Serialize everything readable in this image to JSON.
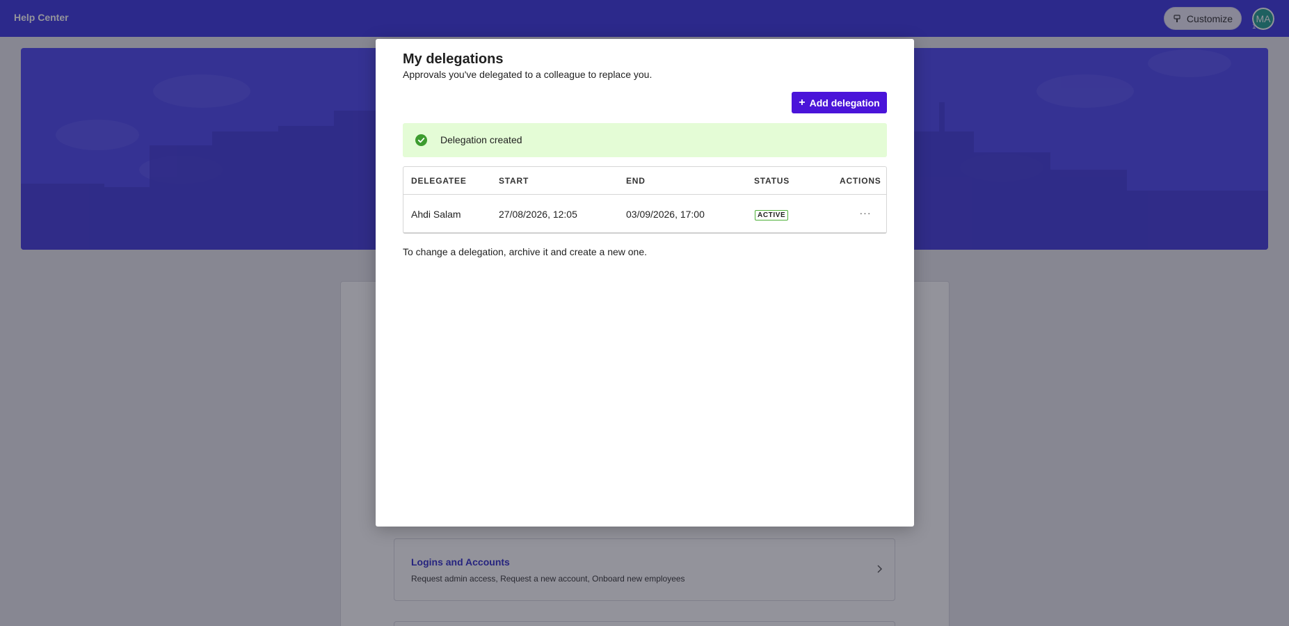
{
  "header": {
    "brand": "Help Center",
    "customize_label": "Customize",
    "avatar_initials": "MA",
    "avatar_badge": "1"
  },
  "page": {
    "category": {
      "title": "Logins and Accounts",
      "description": "Request admin access, Request a new account, Onboard new employees"
    }
  },
  "modal": {
    "title": "My delegations",
    "subtitle": "Approvals you've delegated to a colleague to replace you.",
    "add_button_label": "Add delegation",
    "alert_message": "Delegation created",
    "table": {
      "columns": [
        "DELEGATEE",
        "START",
        "END",
        "STATUS",
        "ACTIONS"
      ],
      "rows": [
        {
          "delegatee": "Ahdi Salam",
          "start": "27/08/2026, 12:05",
          "end": "03/09/2026, 17:00",
          "status": "ACTIVE",
          "actions": "···"
        }
      ]
    },
    "footnote": "To change a delegation, archive it and create a new one."
  },
  "colors": {
    "header_bg": "#3a35e0",
    "primary_button": "#4a14d9",
    "success_bg": "#e4fcd6",
    "success_icon": "#3d9c2f",
    "link": "#2f2bc9"
  },
  "icons": {
    "customize": "paint-brush-icon",
    "alert": "check-circle-icon",
    "category": "chevron-right-icon",
    "actions": "more-horizontal-icon"
  }
}
